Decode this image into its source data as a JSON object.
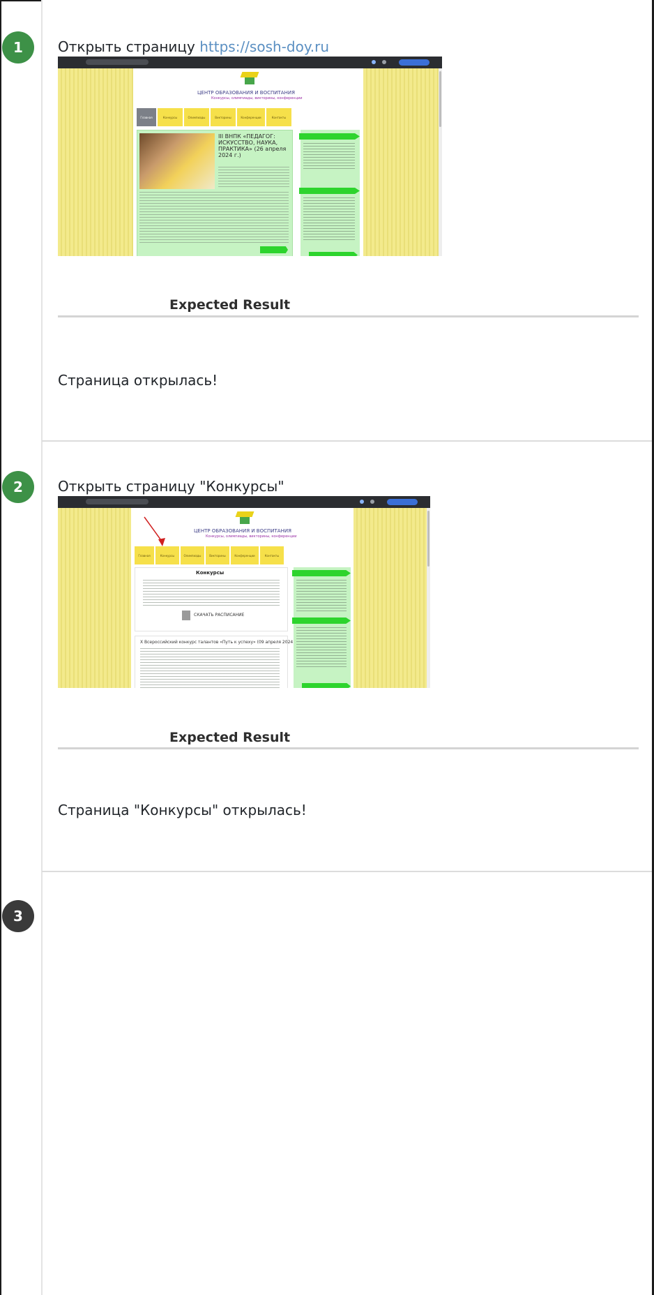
{
  "steps": [
    {
      "number": "1",
      "action_prefix": "Открыть страницу ",
      "action_link": "https://sosh-doy.ru",
      "expected_label": "Expected Result",
      "result": "Страница открылась!",
      "screenshot": {
        "brand": "ЦЕНТР ОБРАЗОВАНИЯ И ВОСПИТАНИЯ",
        "subtitle": "Конкурсы, олимпиады, викторины, конференции",
        "menu": [
          "Главная",
          "Конкурсы",
          "Олимпиады",
          "Викторины",
          "Конференции",
          "Контакты"
        ],
        "headline": "III ВНПК «ПЕДАГОГ: ИСКУССТВО, НАУКА, ПРАКТИКА» (26 апреля 2024 г.)"
      }
    },
    {
      "number": "2",
      "action_prefix": "Открыть страницу \"Конкурсы\"",
      "expected_label": "Expected Result",
      "result": "Страница \"Конкурсы\" открылась!",
      "screenshot": {
        "brand": "ЦЕНТР ОБРАЗОВАНИЯ И ВОСПИТАНИЯ",
        "subtitle": "Конкурсы, олимпиады, викторины, конференции",
        "menu": [
          "Главная",
          "Конкурсы",
          "Олимпиады",
          "Викторины",
          "Конференции",
          "Контакты"
        ],
        "section_title": "Конкурсы",
        "schedule_link": "СКАЧАТЬ РАСПИСАНИЕ",
        "contest_title": "X Всероссийский конкурс талантов «Путь к успеху» (09 апреля 2024 г.)"
      }
    },
    {
      "number": "3"
    }
  ],
  "colors": {
    "step_badge_done": "#3d9147",
    "step_badge_current": "#3a3a3a",
    "link": "#5a8fc2",
    "site_yellow": "#f1e98a",
    "site_green": "#c6f3c3",
    "tag_green": "#2dd42d"
  }
}
